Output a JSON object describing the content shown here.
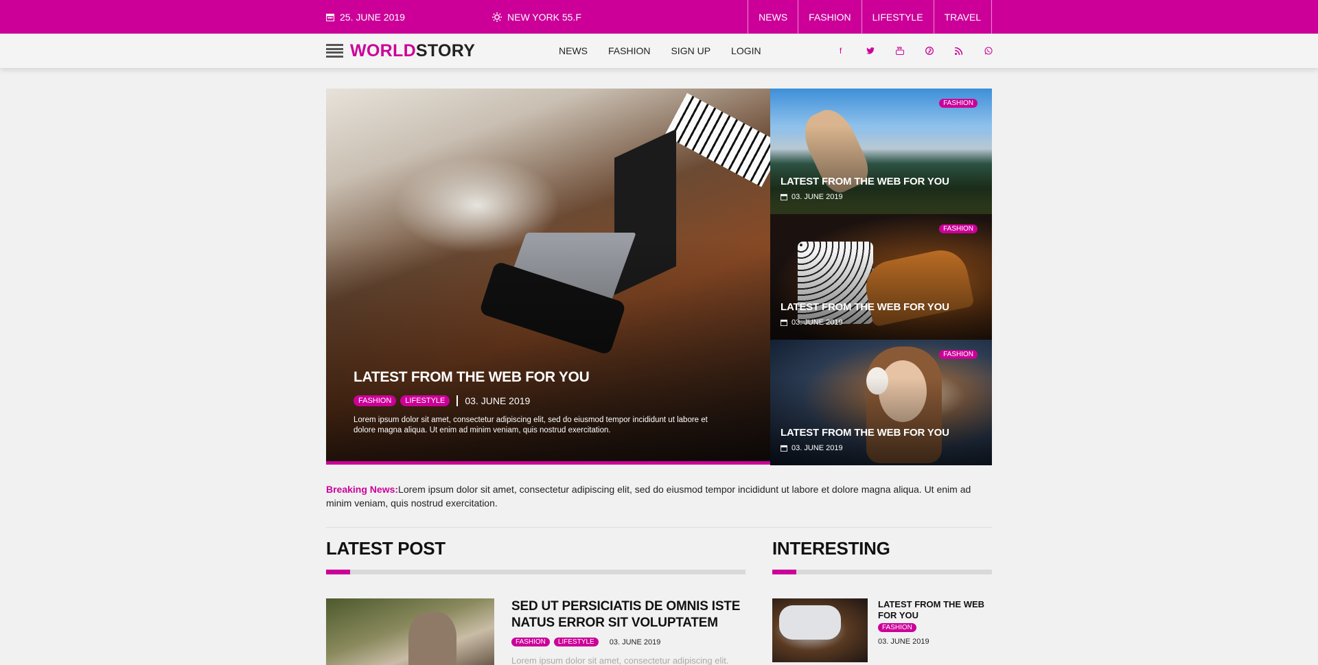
{
  "topbar": {
    "date": "25. JUNE 2019",
    "weather": "NEW YORK 55.F",
    "nav": [
      "NEWS",
      "FASHION",
      "LIFESTYLE",
      "TRAVEL"
    ]
  },
  "header": {
    "logo_a": "WORLD",
    "logo_b": "STORY",
    "nav": [
      "NEWS",
      "FASHION",
      "SIGN UP",
      "LOGIN"
    ],
    "social_icons": [
      "facebook-icon",
      "twitter-icon",
      "youtube-icon",
      "pinterest-icon",
      "rss-icon",
      "whatsapp-icon"
    ]
  },
  "hero": {
    "main": {
      "title": "LATEST FROM THE WEB FOR YOU",
      "tags": [
        "FASHION",
        "LIFESTYLE"
      ],
      "date": "03. JUNE 2019",
      "excerpt": "Lorem ipsum dolor sit amet, consectetur adipiscing elit, sed do eiusmod tempor incididunt ut labore et dolore magna aliqua. Ut enim ad minim veniam, quis nostrud exercitation."
    },
    "side": [
      {
        "tag": "FASHION",
        "title": "LATEST FROM THE WEB FOR YOU",
        "date": "03. JUNE 2019"
      },
      {
        "tag": "FASHION",
        "title": "LATEST FROM THE WEB FOR YOU",
        "date": "03. JUNE 2019"
      },
      {
        "tag": "FASHION",
        "title": "LATEST FROM THE WEB FOR YOU",
        "date": "03. JUNE 2019"
      }
    ]
  },
  "breaking": {
    "label": "Breaking News:",
    "text": "Lorem ipsum dolor sit amet, consectetur adipiscing elit, sed do eiusmod tempor incididunt ut labore et dolore magna aliqua. Ut enim ad minim veniam, quis nostrud exercitation."
  },
  "latest": {
    "heading": "LATEST POST",
    "post": {
      "title": "SED UT PERSICIATIS DE OMNIS ISTE NATUS ERROR SIT VOLUPTATEM",
      "tags": [
        "FASHION",
        "LIFESTYLE"
      ],
      "date": "03. JUNE 2019",
      "excerpt": "Lorem ipsum dolor sit amet, consectetur adipiscing elit."
    }
  },
  "interesting": {
    "heading": "INTERESTING",
    "item": {
      "title": "LATEST FROM THE WEB FOR YOU",
      "tag": "FASHION",
      "date": "03. JUNE 2019"
    }
  },
  "colors": {
    "accent": "#cc0099",
    "background": "#f1f1f1"
  }
}
